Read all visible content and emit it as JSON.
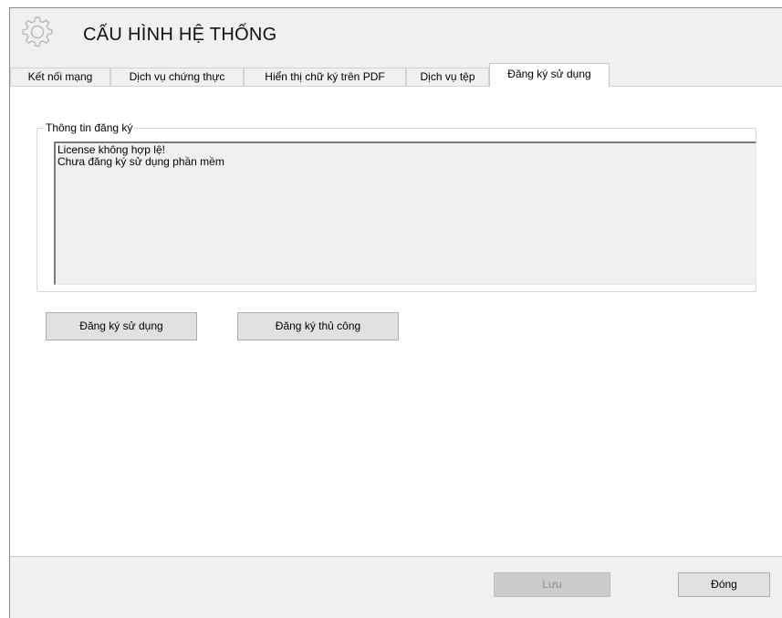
{
  "header": {
    "title": "CẤU HÌNH HỆ THỐNG",
    "icon": "gear-icon"
  },
  "tabs": [
    {
      "label": "Kết nối mạng",
      "active": false
    },
    {
      "label": "Dịch vụ chứng thực",
      "active": false
    },
    {
      "label": "Hiển thị chữ ký trên PDF",
      "active": false
    },
    {
      "label": "Dịch vụ tệp",
      "active": false
    },
    {
      "label": "Đăng ký sử dụng",
      "active": true
    }
  ],
  "registration": {
    "group_label": "Thông tin đăng ký",
    "info_lines": [
      "License không hợp lệ!",
      "Chưa đăng ký sử dụng phần mềm"
    ],
    "register_button": "Đăng ký sử dụng",
    "manual_register_button": "Đăng ký thủ công"
  },
  "footer": {
    "save_button": "Lưu",
    "save_enabled": false,
    "close_button": "Đóng"
  },
  "colors": {
    "window_bg": "#f0f0f0",
    "panel_bg": "#ffffff",
    "button_bg": "#e1e1e1",
    "disabled_button_bg": "#cccccc",
    "disabled_text": "#8d8d8d"
  }
}
